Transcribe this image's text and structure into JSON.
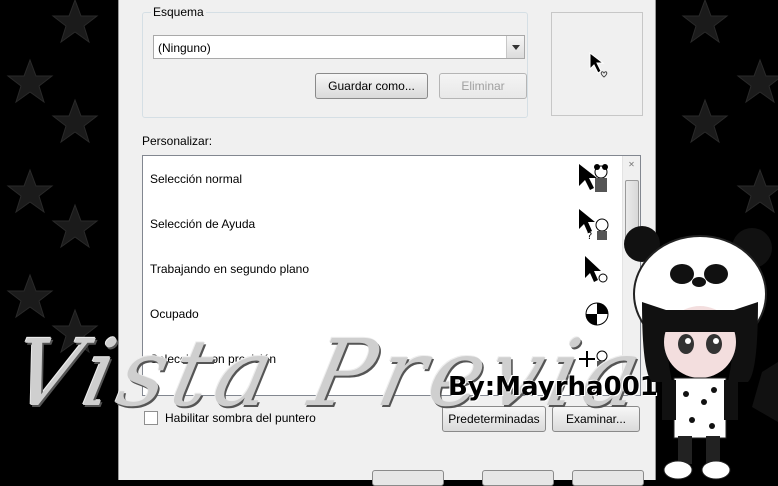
{
  "scheme": {
    "legend": "Esquema",
    "selected": "(Ninguno)",
    "save_as": "Guardar como...",
    "delete": "Eliminar"
  },
  "customize": {
    "label": "Personalizar:",
    "items": [
      {
        "label": "Selección normal",
        "cursor": "arrow-cursor-icon"
      },
      {
        "label": "Selección de Ayuda",
        "cursor": "help-cursor-icon"
      },
      {
        "label": "Trabajando en segundo plano",
        "cursor": "working-cursor-icon"
      },
      {
        "label": "Ocupado",
        "cursor": "busy-cursor-icon"
      },
      {
        "label": "Selección con precisión",
        "cursor": "crosshair-cursor-icon"
      }
    ]
  },
  "shadow_checkbox": {
    "label": "Habilitar sombra del puntero",
    "checked": false
  },
  "buttons": {
    "defaults": "Predeterminadas",
    "browse": "Examinar..."
  },
  "overlay": {
    "title": "Vista Previa",
    "author": "By:Mayrha001"
  }
}
